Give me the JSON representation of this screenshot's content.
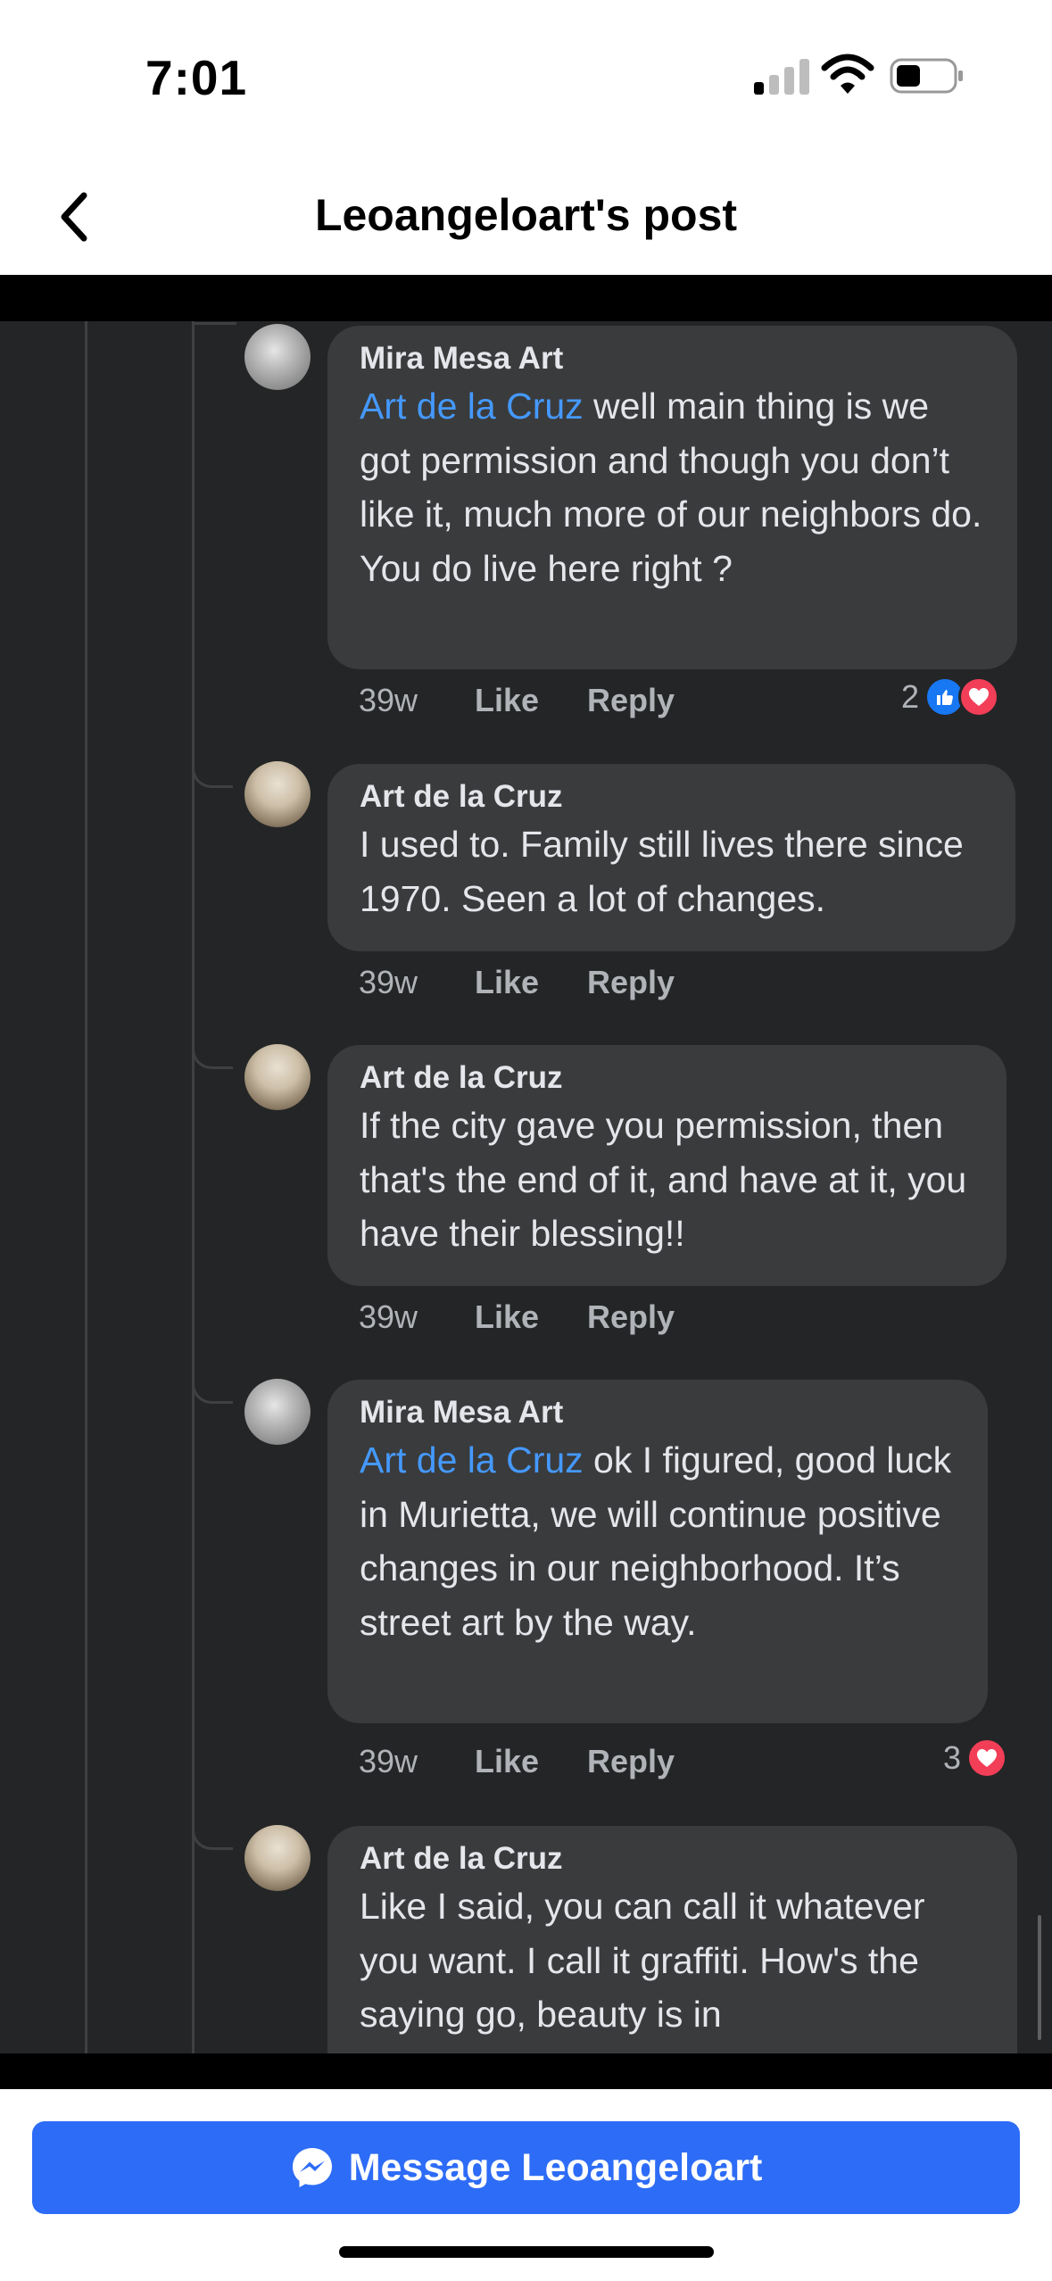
{
  "status_bar": {
    "time": "7:01"
  },
  "header": {
    "title": "Leoangeloart's post",
    "back_icon": "chevron-left-icon"
  },
  "comments": [
    {
      "author": "Mira Mesa Art",
      "mention": "Art de la Cruz",
      "text": " well main thing is we got permission and though you don’t like it, much more of our neighbors do.  You do live here right ?",
      "age": "39w",
      "like": "Like",
      "reply": "Reply",
      "reaction_count": "2",
      "reactions": [
        "like-reaction-icon",
        "love-reaction-icon"
      ]
    },
    {
      "author": "Art de la Cruz",
      "text": "I used to. Family still lives there since 1970. Seen a lot of changes.",
      "age": "39w",
      "like": "Like",
      "reply": "Reply"
    },
    {
      "author": "Art de la Cruz",
      "text": "If the city gave you permission, then that's the end of it, and have at it, you have their blessing!!",
      "age": "39w",
      "like": "Like",
      "reply": "Reply"
    },
    {
      "author": "Mira Mesa Art",
      "mention": "Art de la Cruz",
      "text": " ok I figured, good luck in Murietta, we will continue positive changes in our neighborhood.  It’s street art by the way.",
      "age": "39w",
      "like": "Like",
      "reply": "Reply",
      "reaction_count": "3",
      "reactions": [
        "love-reaction-icon"
      ]
    },
    {
      "author": "Art de la Cruz",
      "text": "Like I said, you can call it whatever you want. I call it graffiti. How's the saying go, beauty is in"
    }
  ],
  "footer": {
    "message_button": "Message Leoangeloart",
    "button_color": "#2d6cf6"
  },
  "colors": {
    "bubble": "#3a3b3c",
    "background": "#242526",
    "mention": "#4599ff"
  }
}
